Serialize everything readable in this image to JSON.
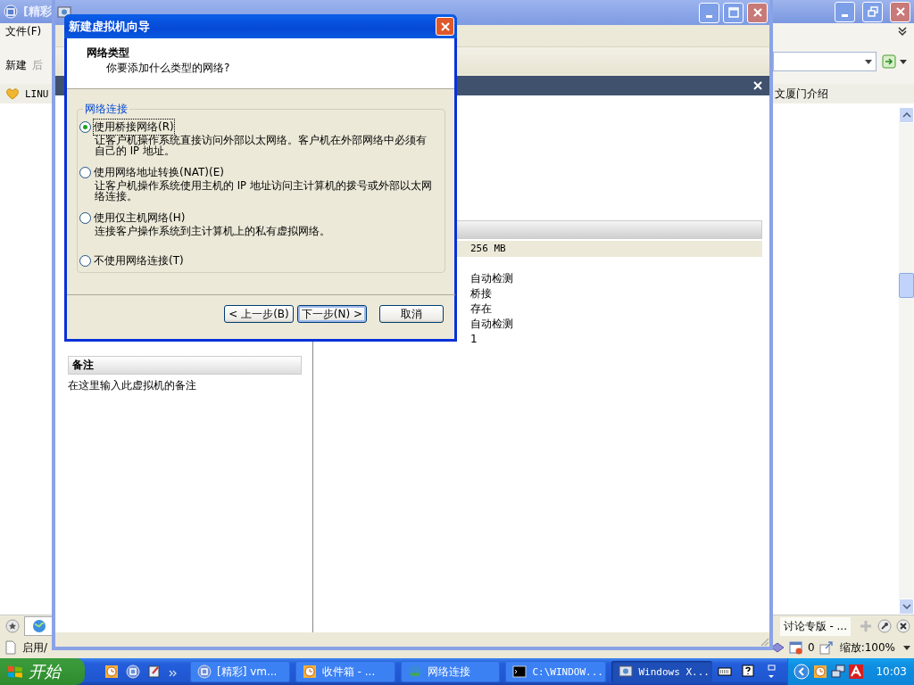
{
  "browser": {
    "title": "[精彩",
    "menu": [
      "文件(F)"
    ],
    "toolbar": [
      {
        "label": "新建"
      },
      {
        "label": "后"
      }
    ],
    "favorites": [
      {
        "label": "LINU"
      },
      {
        "label": "文厦门介绍"
      }
    ],
    "tab": "讨论专版 - ...",
    "status": "启用/",
    "popup_count": "0",
    "zoom": "缩放:100%"
  },
  "vmware": {
    "notes_title": "备注",
    "notes_text": "在这里输入此虚拟机的备注",
    "memory": "256 MB",
    "details": [
      "自动检测",
      "桥接",
      "存在",
      "自动检测",
      "1"
    ]
  },
  "dialog": {
    "title": "新建虚拟机向导",
    "heading": "网络类型",
    "subheading": "你要添加什么类型的网络?",
    "group": "网络连接",
    "options": [
      {
        "label": "使用桥接网络(R)",
        "description": "让客户机操作系统直接访问外部以太网络。客户机在外部网络中必须有自己的 IP 地址。",
        "selected": true
      },
      {
        "label": "使用网络地址转换(NAT)(E)",
        "description": "让客户机操作系统使用主机的 IP 地址访问主计算机的拨号或外部以太网络连接。",
        "selected": false
      },
      {
        "label": "使用仅主机网络(H)",
        "description": "连接客户操作系统到主计算机上的私有虚拟网络。",
        "selected": false
      },
      {
        "label": "不使用网络连接(T)",
        "selected": false
      }
    ],
    "buttons": [
      {
        "label": "< 上一步(B)",
        "default": false
      },
      {
        "label": "下一步(N) >",
        "default": true
      },
      {
        "label": "取消",
        "default": false
      }
    ]
  },
  "taskbar": {
    "start": "开始",
    "tasks": [
      {
        "label": "[精彩] vm...",
        "kind": "browser",
        "selected": false
      },
      {
        "label": "收件箱 - ...",
        "kind": "clock",
        "selected": false
      },
      {
        "label": "网络连接",
        "kind": "network",
        "selected": false
      },
      {
        "label": "C:\\WINDOW...",
        "kind": "cmd",
        "selected": false
      },
      {
        "label": "Windows X...",
        "kind": "vm",
        "selected": true
      }
    ],
    "clock": "10:03"
  }
}
